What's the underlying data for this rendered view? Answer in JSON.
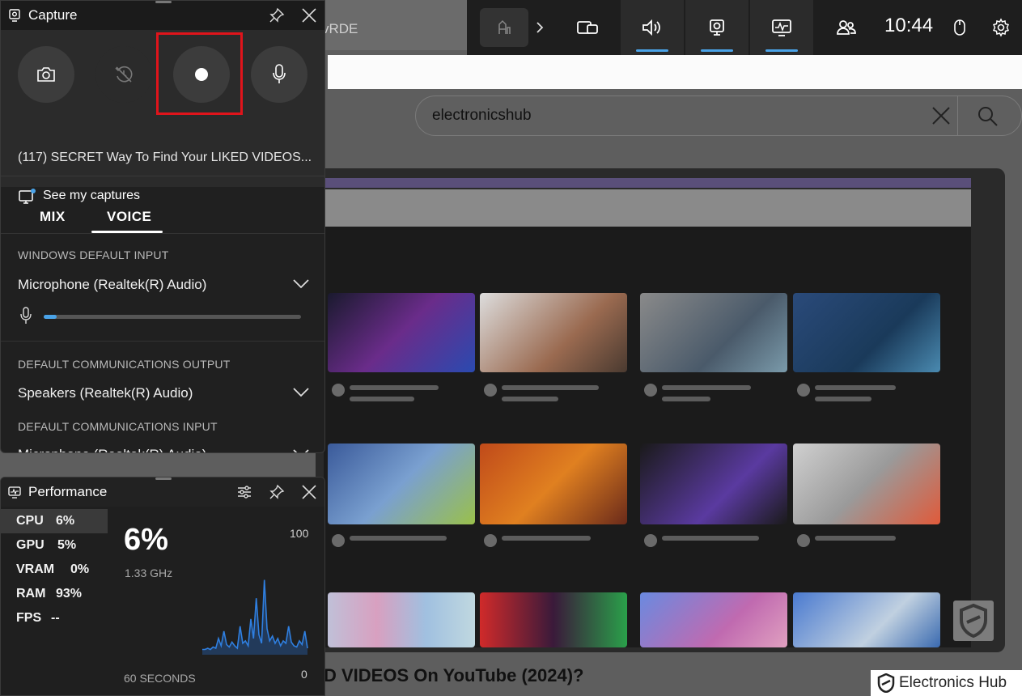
{
  "background": {
    "url_fragment": "vRDE",
    "search_query": "electronicshub",
    "page_heading": "D VIDEOS On YouTube (2024)?",
    "brand_text": "Electronics Hub"
  },
  "gamebar": {
    "time": "10:44",
    "widgets": [
      {
        "name": "widget-menu-icon",
        "active": false
      },
      {
        "name": "audio-icon",
        "active": true
      },
      {
        "name": "capture-icon",
        "active": true
      },
      {
        "name": "performance-icon",
        "active": true
      },
      {
        "name": "social-icon",
        "active": false
      }
    ],
    "accent": "#4aa3e8"
  },
  "capture": {
    "title": "Capture",
    "game_title": "(117) SECRET Way To Find Your LIKED VIDEOS...",
    "see_captures": "See my captures",
    "buttons": [
      "screenshot-icon",
      "record-last-icon",
      "record-icon",
      "microphone-icon"
    ]
  },
  "audio": {
    "tabs": [
      "MIX",
      "VOICE"
    ],
    "active_tab": "VOICE",
    "sections": [
      {
        "label": "WINDOWS DEFAULT INPUT",
        "device": "Microphone (Realtek(R) Audio)"
      },
      {
        "label": "DEFAULT COMMUNICATIONS OUTPUT",
        "device": "Speakers (Realtek(R) Audio)"
      },
      {
        "label": "DEFAULT COMMUNICATIONS INPUT",
        "device": "Microphone (Realtek(R) Audio)"
      }
    ],
    "mic_level": 0.05
  },
  "performance": {
    "title": "Performance",
    "metrics": [
      {
        "label": "CPU",
        "value": "6%"
      },
      {
        "label": "GPU",
        "value": "5%"
      },
      {
        "label": "VRAM",
        "value": "0%"
      },
      {
        "label": "RAM",
        "value": "93%"
      },
      {
        "label": "FPS",
        "value": "--"
      }
    ],
    "selected_value": "6%",
    "frequency": "1.33 GHz",
    "axis_max": "100",
    "axis_min": "0",
    "time_window": "60 SECONDS",
    "chart_data": {
      "type": "line",
      "y_range": [
        0,
        100
      ],
      "values": [
        3,
        3,
        4,
        3,
        5,
        4,
        12,
        6,
        18,
        7,
        5,
        9,
        6,
        4,
        22,
        8,
        10,
        6,
        28,
        12,
        45,
        15,
        8,
        60,
        20,
        10,
        14,
        8,
        12,
        6,
        10,
        8,
        22,
        9,
        6,
        5,
        10,
        7,
        18,
        4
      ]
    }
  }
}
